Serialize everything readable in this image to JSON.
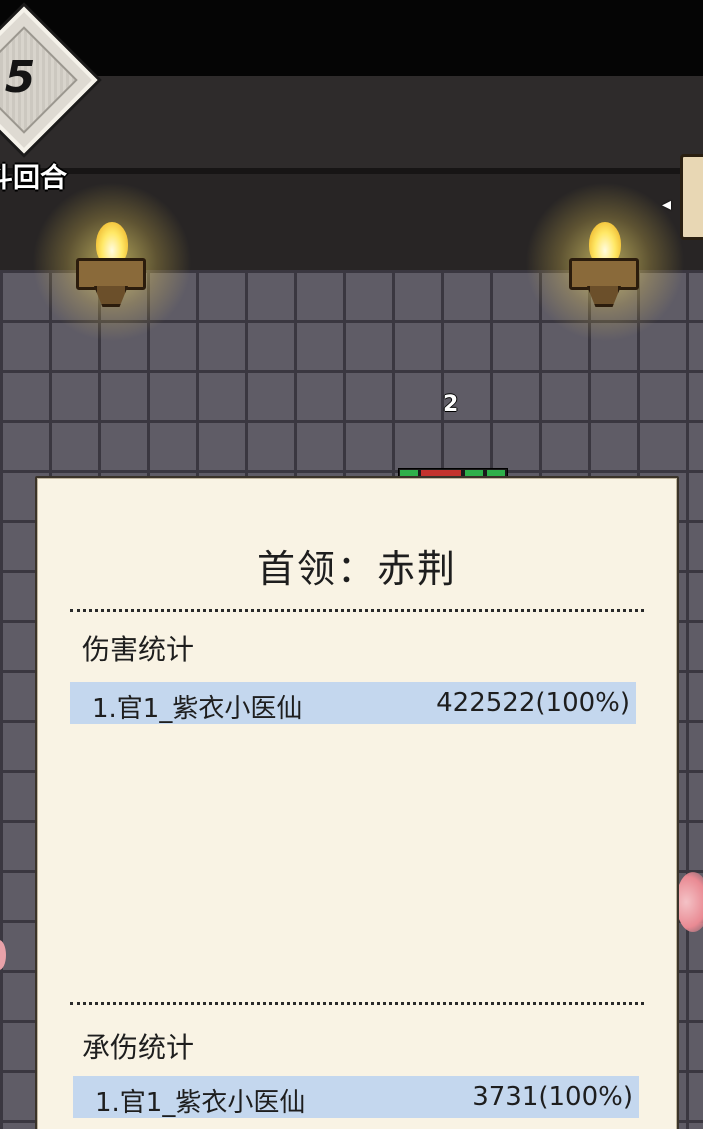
{
  "hud": {
    "round_number": "5",
    "round_label": "斗回合",
    "floating_value": "2"
  },
  "panel": {
    "title": "首领：赤荆",
    "damage_section": {
      "heading": "伤害统计",
      "rows": [
        {
          "name": "1.官1_紫衣小医仙",
          "value": "422522(100%)"
        }
      ]
    },
    "taken_section": {
      "heading": "承伤统计",
      "rows": [
        {
          "name": "1.官1_紫衣小医仙",
          "value": "3731(100%)"
        }
      ]
    }
  },
  "colors": {
    "panel_bg": "#f9f3e4",
    "row_highlight": "#c4d7ee",
    "brick": "#5f5c66",
    "torch_flame": "#ffe866"
  }
}
